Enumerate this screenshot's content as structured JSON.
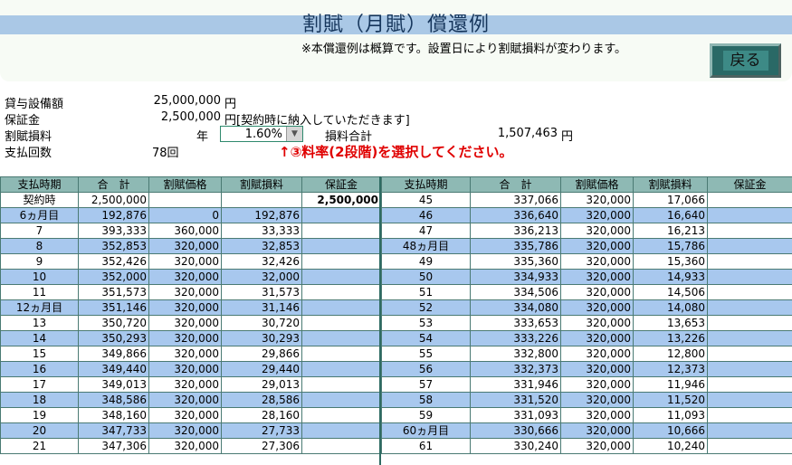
{
  "title": "割賦（月賦）償還例",
  "note": "※本償還例は概算です。設置日により割賦損料が変わります。",
  "back_button": "戻る",
  "summary": {
    "equipment_label": "貸与設備額",
    "equipment_value": "25,000,000",
    "equipment_unit": "円",
    "deposit_label": "保証金",
    "deposit_value": "2,500,000",
    "deposit_unit": "円[契約時に納入していただきます]",
    "rate_label": "割賦損料",
    "rate_period": "年",
    "rate_value": "1.60%",
    "fee_total_label": "損料合計",
    "fee_total_value": "1,507,463",
    "fee_total_unit": "円",
    "count_label": "支払回数",
    "count_value": "78回"
  },
  "instruction": "↑③料率(2段階)を選択してください。",
  "table": {
    "left_headers": [
      "支払時期",
      "合　計",
      "割賦価格",
      "割賦損料",
      "保証金"
    ],
    "right_headers": [
      "支払時期",
      "合　計",
      "割賦価格",
      "割賦損料",
      "保証金"
    ],
    "left_rows": [
      [
        "契約時",
        "2,500,000",
        "",
        "",
        "2,500,000"
      ],
      [
        "6ヵ月目",
        "192,876",
        "0",
        "192,876",
        ""
      ],
      [
        "7",
        "393,333",
        "360,000",
        "33,333",
        ""
      ],
      [
        "8",
        "352,853",
        "320,000",
        "32,853",
        ""
      ],
      [
        "9",
        "352,426",
        "320,000",
        "32,426",
        ""
      ],
      [
        "10",
        "352,000",
        "320,000",
        "32,000",
        ""
      ],
      [
        "11",
        "351,573",
        "320,000",
        "31,573",
        ""
      ],
      [
        "12ヵ月目",
        "351,146",
        "320,000",
        "31,146",
        ""
      ],
      [
        "13",
        "350,720",
        "320,000",
        "30,720",
        ""
      ],
      [
        "14",
        "350,293",
        "320,000",
        "30,293",
        ""
      ],
      [
        "15",
        "349,866",
        "320,000",
        "29,866",
        ""
      ],
      [
        "16",
        "349,440",
        "320,000",
        "29,440",
        ""
      ],
      [
        "17",
        "349,013",
        "320,000",
        "29,013",
        ""
      ],
      [
        "18",
        "348,586",
        "320,000",
        "28,586",
        ""
      ],
      [
        "19",
        "348,160",
        "320,000",
        "28,160",
        ""
      ],
      [
        "20",
        "347,733",
        "320,000",
        "27,733",
        ""
      ],
      [
        "21",
        "347,306",
        "320,000",
        "27,306",
        ""
      ]
    ],
    "right_rows": [
      [
        "45",
        "337,066",
        "320,000",
        "17,066",
        ""
      ],
      [
        "46",
        "336,640",
        "320,000",
        "16,640",
        ""
      ],
      [
        "47",
        "336,213",
        "320,000",
        "16,213",
        ""
      ],
      [
        "48ヵ月目",
        "335,786",
        "320,000",
        "15,786",
        ""
      ],
      [
        "49",
        "335,360",
        "320,000",
        "15,360",
        ""
      ],
      [
        "50",
        "334,933",
        "320,000",
        "14,933",
        ""
      ],
      [
        "51",
        "334,506",
        "320,000",
        "14,506",
        ""
      ],
      [
        "52",
        "334,080",
        "320,000",
        "14,080",
        ""
      ],
      [
        "53",
        "333,653",
        "320,000",
        "13,653",
        ""
      ],
      [
        "54",
        "333,226",
        "320,000",
        "13,226",
        ""
      ],
      [
        "55",
        "332,800",
        "320,000",
        "12,800",
        ""
      ],
      [
        "56",
        "332,373",
        "320,000",
        "12,373",
        ""
      ],
      [
        "57",
        "331,946",
        "320,000",
        "11,946",
        ""
      ],
      [
        "58",
        "331,520",
        "320,000",
        "11,520",
        ""
      ],
      [
        "59",
        "331,093",
        "320,000",
        "11,093",
        ""
      ],
      [
        "60ヵ月目",
        "330,666",
        "320,000",
        "10,666",
        ""
      ],
      [
        "61",
        "330,240",
        "320,000",
        "10,240",
        ""
      ]
    ]
  },
  "colors": {
    "title_bar": "#aac8e6",
    "header_cell": "#8eb9b4",
    "row_blue": "#a8c8ee",
    "instruction": "#e00000",
    "back_button": "#2a6966"
  }
}
